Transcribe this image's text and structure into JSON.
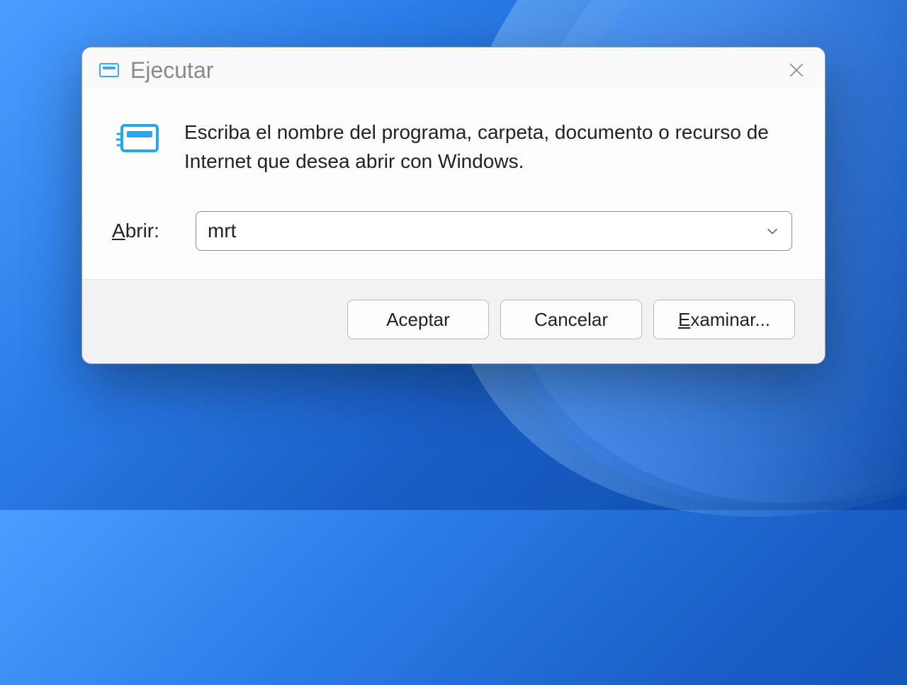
{
  "dialog": {
    "title": "Ejecutar",
    "description": "Escriba el nombre del programa, carpeta, documento o recurso de Internet que desea abrir con Windows.",
    "open_label_prefix": "A",
    "open_label_rest": "brir:",
    "input_value": "mrt",
    "buttons": {
      "ok": "Aceptar",
      "cancel": "Cancelar",
      "browse_prefix": "E",
      "browse_rest": "xaminar..."
    }
  }
}
